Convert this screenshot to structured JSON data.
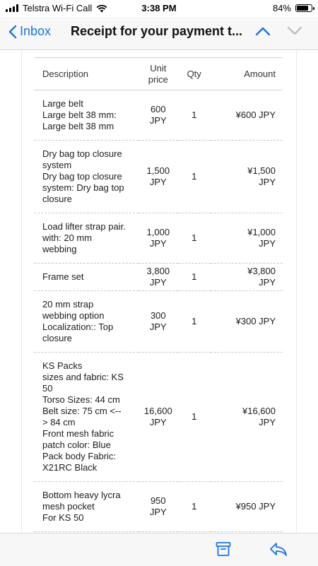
{
  "status_bar": {
    "carrier": "Telstra Wi-Fi Call",
    "time": "3:38 PM",
    "battery": "84%",
    "battery_level": 0.84
  },
  "nav": {
    "back_label": "Inbox",
    "title": "Receipt for your payment t..."
  },
  "table": {
    "headers": {
      "description": "Description",
      "unit_price": "Unit\nprice",
      "qty": "Qty",
      "amount": "Amount"
    },
    "rows": [
      {
        "description": "Large belt\nLarge belt 38 mm:\nLarge belt 38 mm",
        "unit_price": "600\nJPY",
        "qty": "1",
        "amount": "¥600 JPY"
      },
      {
        "description": "Dry bag top closure\nsystem\nDry bag top closure\nsystem: Dry bag top\nclosure",
        "unit_price": "1,500\nJPY",
        "qty": "1",
        "amount": "¥1,500\nJPY"
      },
      {
        "description": "Load lifter strap pair.\nwith: 20 mm\nwebbing",
        "unit_price": "1,000\nJPY",
        "qty": "1",
        "amount": "¥1,000\nJPY"
      },
      {
        "description": "Frame set",
        "unit_price": "3,800\nJPY",
        "qty": "1",
        "amount": "¥3,800\nJPY"
      },
      {
        "description": "20 mm strap\nwebbing option\nLocalization:: Top\nclosure",
        "unit_price": "300\nJPY",
        "qty": "1",
        "amount": "¥300 JPY"
      },
      {
        "description": "KS Packs\nsizes and fabric: KS\n50\nTorso Sizes: 44 cm\nBelt size: 75 cm <--\n> 84 cm\nFront mesh fabric\npatch color: Blue\nPack body Fabric:\nX21RC Black",
        "unit_price": "16,600\nJPY",
        "qty": "1",
        "amount": "¥16,600\nJPY"
      },
      {
        "description": "Bottom heavy lycra\nmesh pocket\nFor KS 50",
        "unit_price": "950\nJPY",
        "qty": "1",
        "amount": "¥950 JPY"
      }
    ]
  }
}
